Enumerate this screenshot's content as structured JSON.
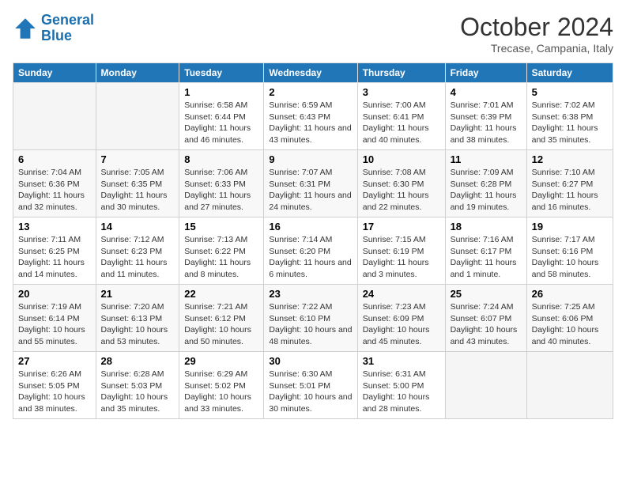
{
  "logo": {
    "line1": "General",
    "line2": "Blue"
  },
  "title": "October 2024",
  "subtitle": "Trecase, Campania, Italy",
  "days_of_week": [
    "Sunday",
    "Monday",
    "Tuesday",
    "Wednesday",
    "Thursday",
    "Friday",
    "Saturday"
  ],
  "weeks": [
    [
      {
        "day": "",
        "info": ""
      },
      {
        "day": "",
        "info": ""
      },
      {
        "day": "1",
        "info": "Sunrise: 6:58 AM\nSunset: 6:44 PM\nDaylight: 11 hours and 46 minutes."
      },
      {
        "day": "2",
        "info": "Sunrise: 6:59 AM\nSunset: 6:43 PM\nDaylight: 11 hours and 43 minutes."
      },
      {
        "day": "3",
        "info": "Sunrise: 7:00 AM\nSunset: 6:41 PM\nDaylight: 11 hours and 40 minutes."
      },
      {
        "day": "4",
        "info": "Sunrise: 7:01 AM\nSunset: 6:39 PM\nDaylight: 11 hours and 38 minutes."
      },
      {
        "day": "5",
        "info": "Sunrise: 7:02 AM\nSunset: 6:38 PM\nDaylight: 11 hours and 35 minutes."
      }
    ],
    [
      {
        "day": "6",
        "info": "Sunrise: 7:04 AM\nSunset: 6:36 PM\nDaylight: 11 hours and 32 minutes."
      },
      {
        "day": "7",
        "info": "Sunrise: 7:05 AM\nSunset: 6:35 PM\nDaylight: 11 hours and 30 minutes."
      },
      {
        "day": "8",
        "info": "Sunrise: 7:06 AM\nSunset: 6:33 PM\nDaylight: 11 hours and 27 minutes."
      },
      {
        "day": "9",
        "info": "Sunrise: 7:07 AM\nSunset: 6:31 PM\nDaylight: 11 hours and 24 minutes."
      },
      {
        "day": "10",
        "info": "Sunrise: 7:08 AM\nSunset: 6:30 PM\nDaylight: 11 hours and 22 minutes."
      },
      {
        "day": "11",
        "info": "Sunrise: 7:09 AM\nSunset: 6:28 PM\nDaylight: 11 hours and 19 minutes."
      },
      {
        "day": "12",
        "info": "Sunrise: 7:10 AM\nSunset: 6:27 PM\nDaylight: 11 hours and 16 minutes."
      }
    ],
    [
      {
        "day": "13",
        "info": "Sunrise: 7:11 AM\nSunset: 6:25 PM\nDaylight: 11 hours and 14 minutes."
      },
      {
        "day": "14",
        "info": "Sunrise: 7:12 AM\nSunset: 6:23 PM\nDaylight: 11 hours and 11 minutes."
      },
      {
        "day": "15",
        "info": "Sunrise: 7:13 AM\nSunset: 6:22 PM\nDaylight: 11 hours and 8 minutes."
      },
      {
        "day": "16",
        "info": "Sunrise: 7:14 AM\nSunset: 6:20 PM\nDaylight: 11 hours and 6 minutes."
      },
      {
        "day": "17",
        "info": "Sunrise: 7:15 AM\nSunset: 6:19 PM\nDaylight: 11 hours and 3 minutes."
      },
      {
        "day": "18",
        "info": "Sunrise: 7:16 AM\nSunset: 6:17 PM\nDaylight: 11 hours and 1 minute."
      },
      {
        "day": "19",
        "info": "Sunrise: 7:17 AM\nSunset: 6:16 PM\nDaylight: 10 hours and 58 minutes."
      }
    ],
    [
      {
        "day": "20",
        "info": "Sunrise: 7:19 AM\nSunset: 6:14 PM\nDaylight: 10 hours and 55 minutes."
      },
      {
        "day": "21",
        "info": "Sunrise: 7:20 AM\nSunset: 6:13 PM\nDaylight: 10 hours and 53 minutes."
      },
      {
        "day": "22",
        "info": "Sunrise: 7:21 AM\nSunset: 6:12 PM\nDaylight: 10 hours and 50 minutes."
      },
      {
        "day": "23",
        "info": "Sunrise: 7:22 AM\nSunset: 6:10 PM\nDaylight: 10 hours and 48 minutes."
      },
      {
        "day": "24",
        "info": "Sunrise: 7:23 AM\nSunset: 6:09 PM\nDaylight: 10 hours and 45 minutes."
      },
      {
        "day": "25",
        "info": "Sunrise: 7:24 AM\nSunset: 6:07 PM\nDaylight: 10 hours and 43 minutes."
      },
      {
        "day": "26",
        "info": "Sunrise: 7:25 AM\nSunset: 6:06 PM\nDaylight: 10 hours and 40 minutes."
      }
    ],
    [
      {
        "day": "27",
        "info": "Sunrise: 6:26 AM\nSunset: 5:05 PM\nDaylight: 10 hours and 38 minutes."
      },
      {
        "day": "28",
        "info": "Sunrise: 6:28 AM\nSunset: 5:03 PM\nDaylight: 10 hours and 35 minutes."
      },
      {
        "day": "29",
        "info": "Sunrise: 6:29 AM\nSunset: 5:02 PM\nDaylight: 10 hours and 33 minutes."
      },
      {
        "day": "30",
        "info": "Sunrise: 6:30 AM\nSunset: 5:01 PM\nDaylight: 10 hours and 30 minutes."
      },
      {
        "day": "31",
        "info": "Sunrise: 6:31 AM\nSunset: 5:00 PM\nDaylight: 10 hours and 28 minutes."
      },
      {
        "day": "",
        "info": ""
      },
      {
        "day": "",
        "info": ""
      }
    ]
  ]
}
